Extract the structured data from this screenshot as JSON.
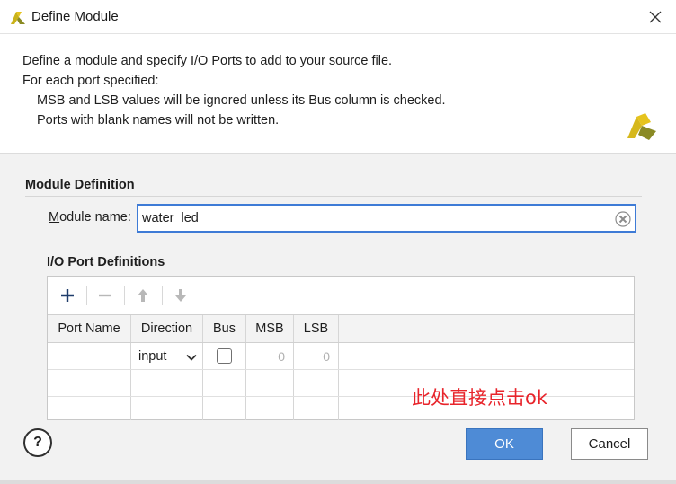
{
  "window": {
    "title": "Define Module",
    "icons": {
      "app": "vivado-logo-icon",
      "close": "close-icon"
    }
  },
  "intro": {
    "line1": "Define a module and specify I/O Ports to add to your source file.",
    "line2": "For each port specified:",
    "line3": "MSB and LSB values will be ignored unless its Bus column is checked.",
    "line4": "Ports with blank names will not be written."
  },
  "module_definition": {
    "title": "Module Definition",
    "label_accel": "M",
    "label_rest": "odule name:",
    "value": "water_led"
  },
  "io_ports": {
    "title": "I/O Port Definitions",
    "toolbar": {
      "add": "plus-icon",
      "remove": "minus-icon",
      "up": "arrow-up-icon",
      "down": "arrow-down-icon"
    },
    "columns": [
      "Port Name",
      "Direction",
      "Bus",
      "MSB",
      "LSB"
    ],
    "rows": [
      {
        "port_name": "",
        "direction": "input",
        "bus": false,
        "msb": "0",
        "lsb": "0"
      }
    ]
  },
  "annotation": "此处直接点击ok",
  "buttons": {
    "help": "?",
    "ok": "OK",
    "cancel": "Cancel"
  },
  "colors": {
    "accent": "#4e8bd6",
    "focus_border": "#3e7bd6",
    "annotation": "#e8242b",
    "brand_yellow": "#e6c31d",
    "brand_olive": "#8a8a24"
  }
}
